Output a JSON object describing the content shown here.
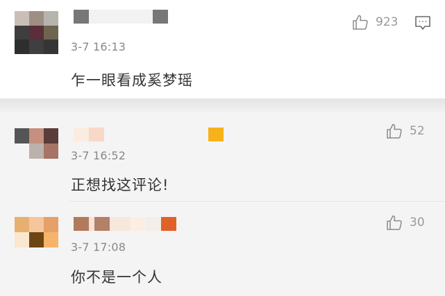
{
  "comments": [
    {
      "timestamp": "3-7 16:13",
      "text": "乍一眼看成奚梦瑶",
      "likes": "923",
      "avatar_icon": "blurred-avatar",
      "avatar_colors": [
        "#c9bfb8",
        "#9e8f85",
        "#b7b3ad",
        "#3e3e3e",
        "#5a2e3a",
        "#6d6550",
        "#2e2e2e",
        "#3f3f3f",
        "#353535"
      ],
      "name_colors": [
        "#777777",
        "#f2f2f2",
        "#f2f2f2",
        "#777777"
      ]
    },
    {
      "timestamp": "3-7 16:52",
      "text": "正想找这评论!",
      "likes": "52",
      "avatar_icon": "blurred-avatar",
      "avatar_colors": [
        "#555555",
        "#c59080",
        "#5a3c38",
        "#f4f4f4",
        "#bcb2ad",
        "#a77466"
      ],
      "name_colors": [
        "#fbece2",
        "#f8d8c6",
        "#f4f4f4",
        "#f4f4f4",
        "#f7b21a"
      ]
    },
    {
      "timestamp": "3-7 17:08",
      "text": "你不是一个人",
      "likes": "30",
      "avatar_icon": "blurred-avatar",
      "avatar_colors": [
        "#e8b070",
        "#f5c69a",
        "#e6a06a",
        "#fbe6cf",
        "#6b4612",
        "#f6b46a"
      ],
      "name_colors": [
        "#b27a5c",
        "#f7e2d3",
        "#b38068",
        "#f7e8dc",
        "#fbeee5",
        "#f3eee9",
        "#e06228"
      ]
    }
  ]
}
